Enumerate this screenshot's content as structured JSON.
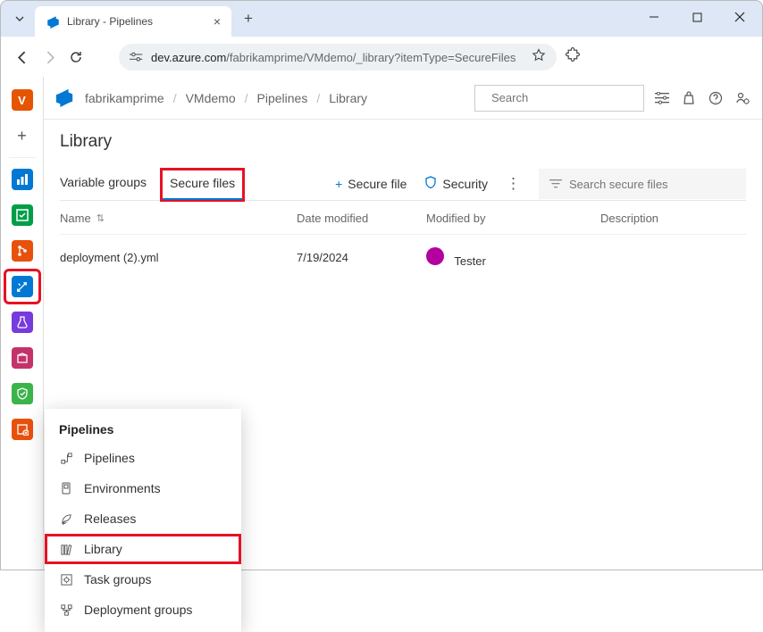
{
  "browser": {
    "tab_title": "Library - Pipelines",
    "url_host": "dev.azure.com",
    "url_path": "/fabrikamprime/VMdemo/_library?itemType=SecureFiles"
  },
  "header": {
    "breadcrumbs": [
      "fabrikamprime",
      "VMdemo",
      "Pipelines",
      "Library"
    ],
    "search_placeholder": "Search"
  },
  "page": {
    "title": "Library",
    "tabs": [
      {
        "label": "Variable groups",
        "active": false
      },
      {
        "label": "Secure files",
        "active": true
      }
    ],
    "actions": {
      "secure_file": "Secure file",
      "security": "Security"
    },
    "filter_placeholder": "Search secure files",
    "columns": {
      "name": "Name",
      "date": "Date modified",
      "modified_by": "Modified by",
      "description": "Description"
    },
    "rows": [
      {
        "name": "deployment (2).yml",
        "date": "7/19/2024",
        "modified_by": "Tester",
        "description": ""
      }
    ]
  },
  "rail": {
    "items": [
      {
        "name": "org",
        "color": "#e55400",
        "label": "V"
      },
      {
        "name": "new",
        "color": "transparent",
        "label": "+"
      },
      {
        "name": "overview",
        "color": "#0078d4"
      },
      {
        "name": "boards",
        "color": "#009e49"
      },
      {
        "name": "repos",
        "color": "#e8510c"
      },
      {
        "name": "pipelines",
        "color": "#0078d4"
      },
      {
        "name": "test-plans",
        "color": "#773adc"
      },
      {
        "name": "artifacts",
        "color": "#c4326b"
      },
      {
        "name": "compliance",
        "color": "#3bb44a"
      },
      {
        "name": "ext",
        "color": "#e8510c"
      }
    ]
  },
  "flyout": {
    "title": "Pipelines",
    "items": [
      {
        "icon": "pipelines",
        "label": "Pipelines"
      },
      {
        "icon": "environments",
        "label": "Environments"
      },
      {
        "icon": "releases",
        "label": "Releases"
      },
      {
        "icon": "library",
        "label": "Library",
        "highlight": true
      },
      {
        "icon": "task-groups",
        "label": "Task groups"
      },
      {
        "icon": "deployment-groups",
        "label": "Deployment groups"
      }
    ]
  }
}
